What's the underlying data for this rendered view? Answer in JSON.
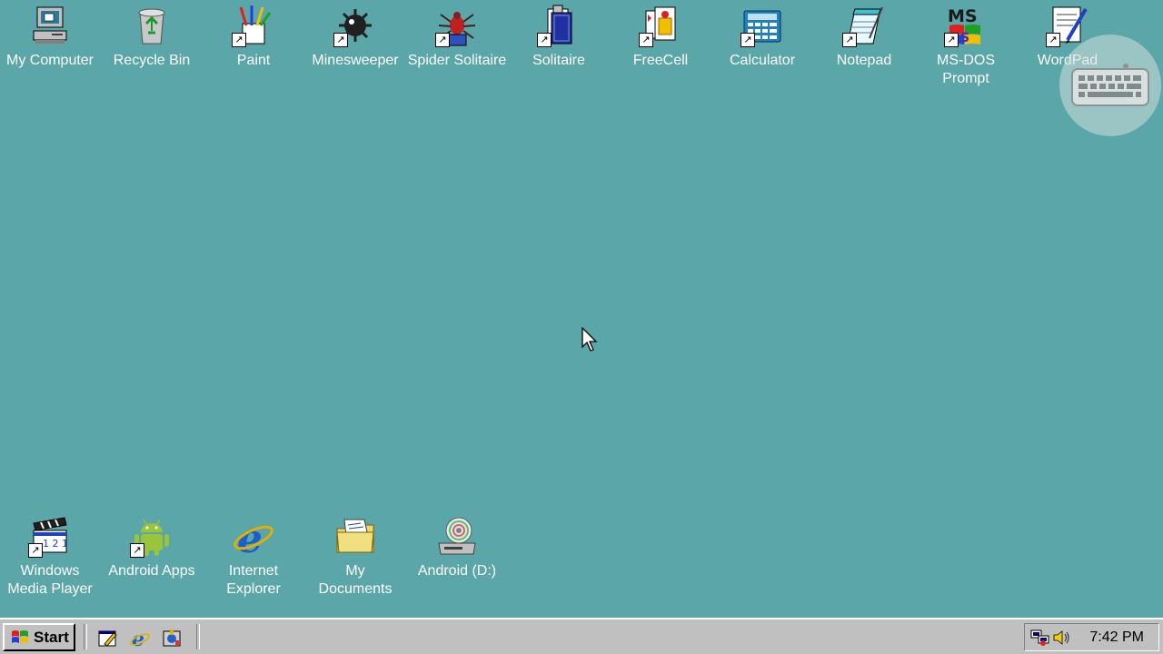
{
  "desktop": {
    "background": "#5aa6a8",
    "top_icons": [
      {
        "label": "My Computer",
        "icon": "computer-icon",
        "shortcut": false
      },
      {
        "label": "Recycle Bin",
        "icon": "recycle-bin-icon",
        "shortcut": false
      },
      {
        "label": "Paint",
        "icon": "paint-icon",
        "shortcut": true
      },
      {
        "label": "Minesweeper",
        "icon": "mine-icon",
        "shortcut": true
      },
      {
        "label": "Spider Solitaire",
        "icon": "spider-icon",
        "shortcut": true
      },
      {
        "label": "Solitaire",
        "icon": "cards-icon",
        "shortcut": true
      },
      {
        "label": "FreeCell",
        "icon": "freecell-icon",
        "shortcut": true
      },
      {
        "label": "Calculator",
        "icon": "calculator-icon",
        "shortcut": true
      },
      {
        "label": "Notepad",
        "icon": "notepad-icon",
        "shortcut": true
      },
      {
        "label": "MS-DOS\nPrompt",
        "icon": "msdos-icon",
        "shortcut": true
      },
      {
        "label": "WordPad",
        "icon": "wordpad-icon",
        "shortcut": true
      }
    ],
    "bottom_icons": [
      {
        "label": "Windows\nMedia Player",
        "icon": "clapper-icon",
        "shortcut": true
      },
      {
        "label": "Android Apps",
        "icon": "android-icon",
        "shortcut": true
      },
      {
        "label": "Internet\nExplorer",
        "icon": "ie-icon",
        "shortcut": false
      },
      {
        "label": "My\nDocuments",
        "icon": "folder-icon",
        "shortcut": false
      },
      {
        "label": "Android (D:)",
        "icon": "cd-drive-icon",
        "shortcut": false
      }
    ]
  },
  "taskbar": {
    "start_label": "Start",
    "quick_launch": [
      "show-desktop-icon",
      "ie-icon",
      "channels-icon"
    ],
    "tray_icons": [
      "network-icon",
      "volume-icon"
    ],
    "clock": "7:42 PM"
  },
  "overlay": {
    "keyboard_button": "keyboard-icon"
  }
}
